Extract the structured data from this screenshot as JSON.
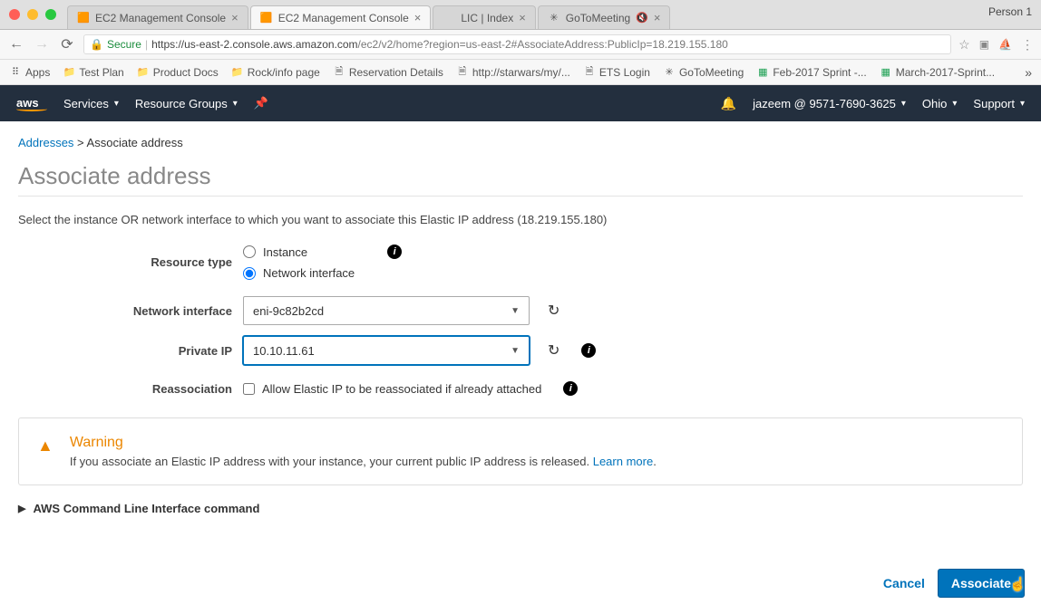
{
  "browser": {
    "profile": "Person 1",
    "tabs": [
      {
        "title": "EC2 Management Console",
        "icon": "🟧"
      },
      {
        "title": "EC2 Management Console",
        "icon": "🟧",
        "active": true
      },
      {
        "title": "LIC | Index",
        "icon": ""
      },
      {
        "title": "GoToMeeting",
        "icon": "✳",
        "muted": true
      }
    ],
    "secure_label": "Secure",
    "url_host": "https://us-east-2.console.aws.amazon.com",
    "url_path": "/ec2/v2/home?region=us-east-2#AssociateAddress:PublicIp=18.219.155.180",
    "bookmarks": [
      {
        "label": "Apps",
        "icon": "⠿"
      },
      {
        "label": "Test Plan",
        "icon": "📁"
      },
      {
        "label": "Product Docs",
        "icon": "📁"
      },
      {
        "label": "Rock/info page",
        "icon": "📁"
      },
      {
        "label": "Reservation Details",
        "icon": "🗎"
      },
      {
        "label": "http://starwars/my/...",
        "icon": "🗎"
      },
      {
        "label": "ETS Login",
        "icon": "🗎"
      },
      {
        "label": "GoToMeeting",
        "icon": "✳"
      },
      {
        "label": "Feb-2017 Sprint -...",
        "icon": "▦"
      },
      {
        "label": "March-2017-Sprint...",
        "icon": "▦"
      }
    ]
  },
  "awsnav": {
    "services": "Services",
    "resource_groups": "Resource Groups",
    "account": "jazeem @ 9571-7690-3625",
    "region": "Ohio",
    "support": "Support"
  },
  "breadcrumb": {
    "parent": "Addresses",
    "sep": ">",
    "current": "Associate address"
  },
  "title": "Associate address",
  "intro": "Select the instance OR network interface to which you want to associate this Elastic IP address (18.219.155.180)",
  "form": {
    "resource_type_label": "Resource type",
    "instance_label": "Instance",
    "network_interface_label": "Network interface",
    "network_interface_field_label": "Network interface",
    "network_interface_value": "eni-9c82b2cd",
    "private_ip_label": "Private IP",
    "private_ip_value": "10.10.11.61",
    "reassociation_label": "Reassociation",
    "reassociation_text": "Allow Elastic IP to be reassociated if already attached"
  },
  "warning": {
    "title": "Warning",
    "text": "If you associate an Elastic IP address with your instance, your current public IP address is released.",
    "link": "Learn more"
  },
  "expander": "AWS Command Line Interface command",
  "footer": {
    "cancel": "Cancel",
    "associate": "Associate"
  }
}
